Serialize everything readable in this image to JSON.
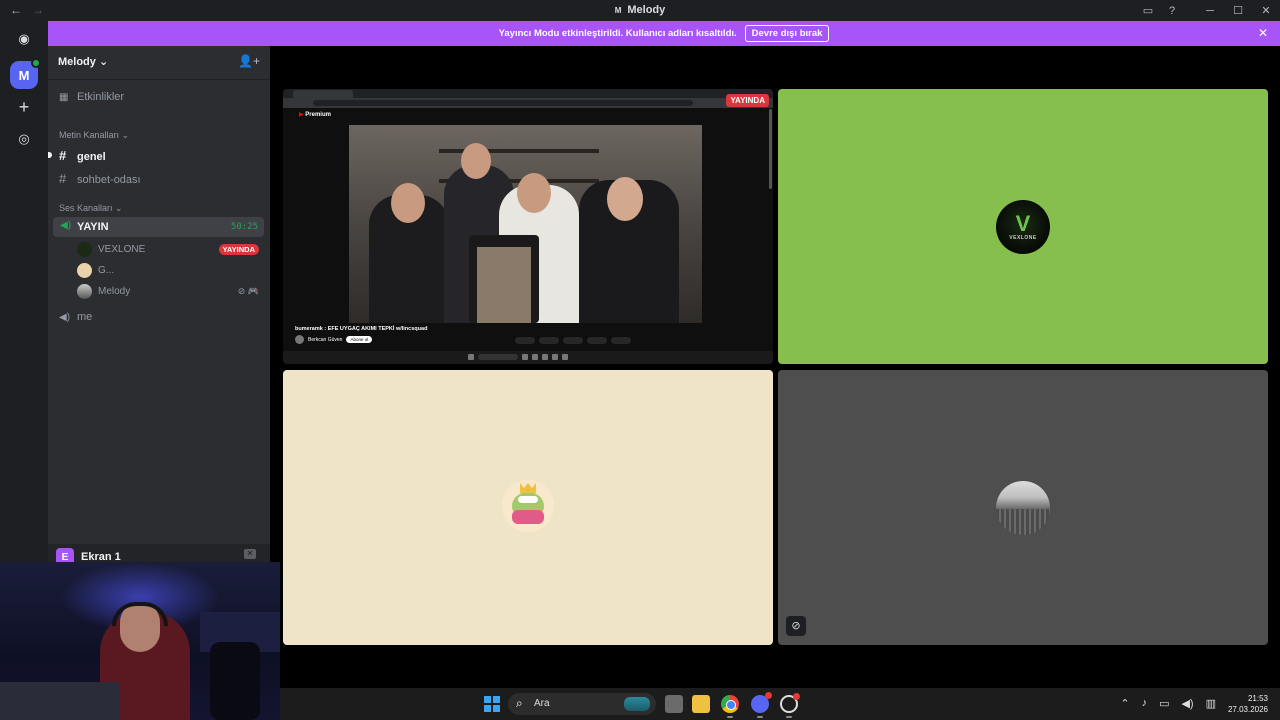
{
  "window": {
    "title": "Melody",
    "back_label": "←",
    "forward_label": "→"
  },
  "banner": {
    "message": "Yayıncı Modu etkinleştirildi. Kullanıcı adları kısaltıldı.",
    "button_label": "Devre dışı bırak"
  },
  "rail": {
    "server_initial": "M"
  },
  "sidebar": {
    "server_name": "Melody",
    "events_label": "Etkinlikler",
    "text_category": "Metin Kanalları",
    "text_channels": [
      "genel",
      "sohbet-odası"
    ],
    "voice_category": "Ses Kanalları",
    "voice_channel": {
      "name": "YAYIN",
      "time": "50:25",
      "members": [
        {
          "name": "VEXLONE",
          "badge": "YAYINDA"
        },
        {
          "name": "G..."
        },
        {
          "name": "Melody"
        }
      ]
    },
    "voice_channel_2": "me"
  },
  "ekran": {
    "badge": "E",
    "label": "Ekran 1"
  },
  "stream": {
    "live_badge": "YAYINDA",
    "youtube_label": "Premium",
    "video_title": "bumeramk : EFE UYGAÇ AKIMI TEPKİ w/lincsquad",
    "channel_name": "Berkcan Güven",
    "subscribe_label": "Abone ol"
  },
  "tiles": {
    "vexlone_text": "VEXLONE",
    "vexlone_mark": "V"
  },
  "taskbar": {
    "search_placeholder": "Ara",
    "time": "21:53",
    "date": "27.03.2026"
  },
  "colors": {
    "banner": "#a855f7",
    "live": "#da373c",
    "voice_active": "#23a55a",
    "vexlone_tile": "#86bf4d",
    "frog_tile": "#f0e4c8",
    "melody_tile": "#4e4e4e"
  }
}
